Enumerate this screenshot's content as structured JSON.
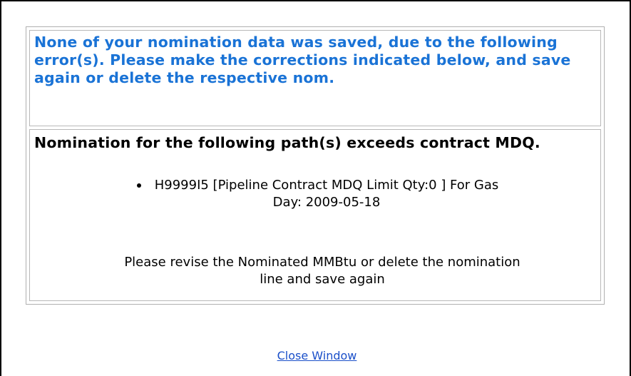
{
  "error_message": {
    "heading": "None of your nomination data was saved, due to the following error(s). Please make the corrections indicated below, and save again or delete the respective nom.",
    "heading_color": "#1a73d6"
  },
  "path_error": {
    "title": "Nomination for the following path(s) exceeds contract MDQ.",
    "items": [
      "H9999I5 [Pipeline Contract MDQ Limit Qty:0 ] For Gas Day: 2009-05-18"
    ],
    "instruction": "Please revise the Nominated MMBtu or delete the nomination line and save again"
  },
  "footer": {
    "close_label": "Close Window",
    "link_color": "#1a4fc9"
  }
}
